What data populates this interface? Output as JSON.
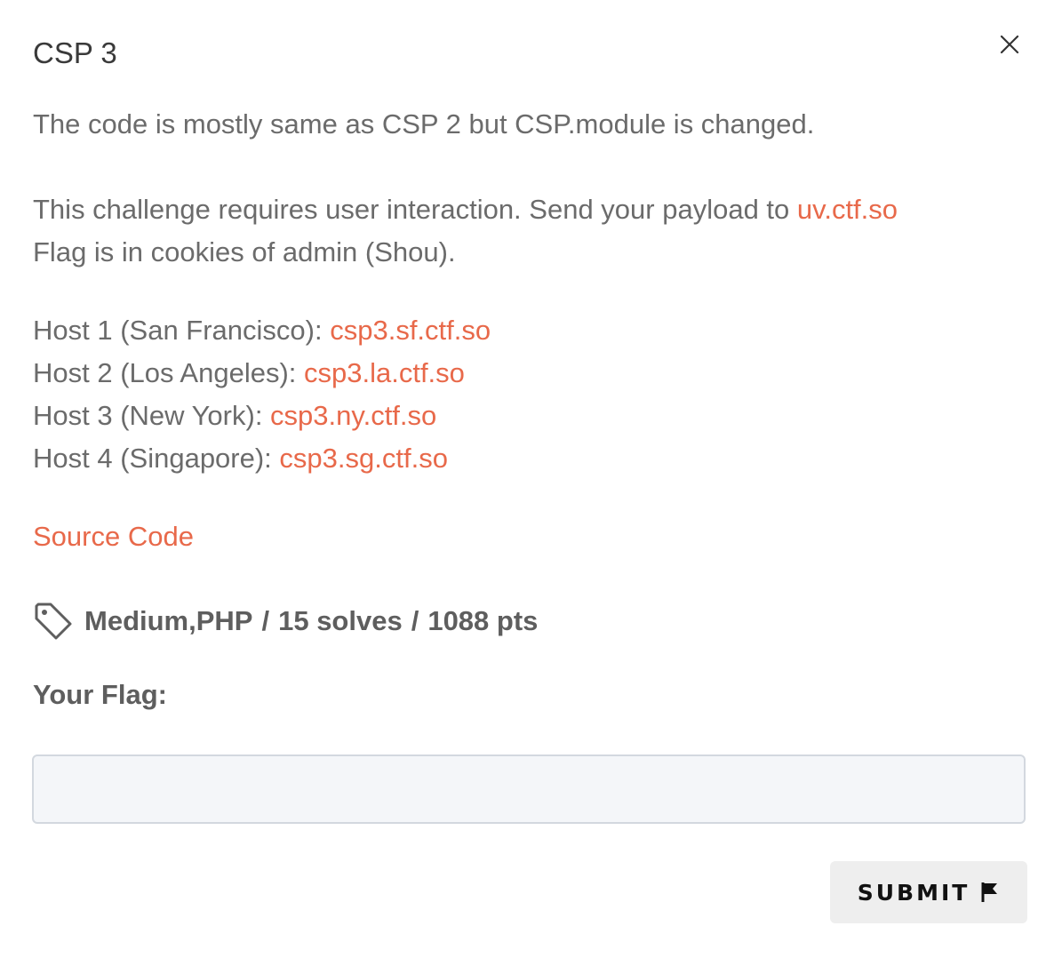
{
  "modal": {
    "title": "CSP 3",
    "close_icon": "close-icon"
  },
  "description": {
    "line1": "The code is mostly same as CSP 2 but CSP.module is changed.",
    "interaction_prefix": "This challenge requires user interaction. Send your payload to ",
    "interaction_link": "uv.ctf.so",
    "flag_location": "Flag is in cookies of admin (Shou).",
    "hosts": [
      {
        "label": "Host 1 (San Francisco): ",
        "link": "csp3.sf.ctf.so"
      },
      {
        "label": "Host 2 (Los Angeles): ",
        "link": "csp3.la.ctf.so"
      },
      {
        "label": "Host 3 (New York): ",
        "link": "csp3.ny.ctf.so"
      },
      {
        "label": "Host 4 (Singapore): ",
        "link": "csp3.sg.ctf.so"
      }
    ],
    "source_code_link": "Source Code"
  },
  "meta": {
    "tag_icon": "tag-icon",
    "tags": "Medium,PHP",
    "separator": "/",
    "solves": "15 solves",
    "points": "1088 pts"
  },
  "flag_form": {
    "label": "Your Flag:",
    "input_value": "",
    "input_placeholder": "",
    "submit_label": "SUBMIT",
    "submit_icon": "flag-icon"
  },
  "colors": {
    "link": "#e8694a",
    "text": "#6b6b6b",
    "title": "#3a3a3a",
    "input_bg": "#f4f6f9",
    "input_border": "#d3d8df",
    "button_bg": "#eeeeee"
  }
}
